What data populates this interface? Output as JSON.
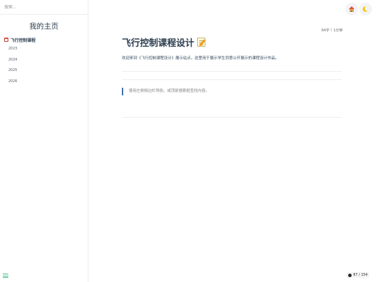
{
  "sidebar": {
    "search_placeholder": "搜索...",
    "site_name": "我的主页",
    "nav_root": "飞行控制课程",
    "years": [
      "2023",
      "2024",
      "2025",
      "2026"
    ]
  },
  "header": {
    "home_icon": "house-icon",
    "theme_icon": "moon-icon"
  },
  "page": {
    "word_count": "64字",
    "separator": "|",
    "read_time": "1分钟",
    "title": "飞行控制课程设计",
    "title_icon": "memo-icon",
    "intro": "欢迎来到《飞行控制课程设计》展示站点，这里用于展示学生同意公开展示的课程设计作品。",
    "tip": "使用左侧侧边栏导航，或顶部搜索框查找内容。"
  },
  "footer": {
    "badge_text": "87 / 154"
  },
  "colors": {
    "accent": "#42b983",
    "tip_bar": "#3f72af",
    "title": "#2c3e50"
  }
}
